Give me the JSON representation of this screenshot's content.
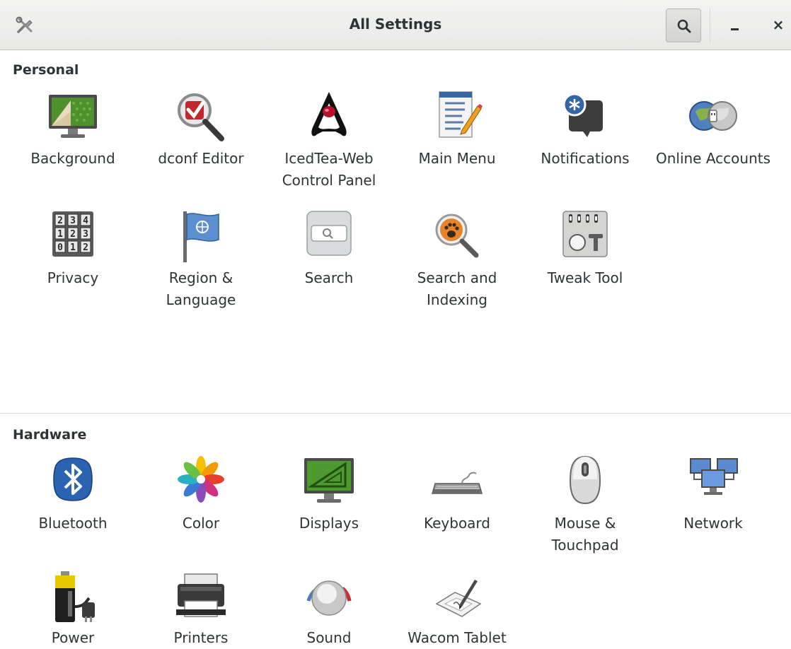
{
  "window": {
    "title": "All Settings",
    "tools_icon": "tools-icon",
    "search_icon": "search-icon",
    "minimize_label": "",
    "close_label": "×"
  },
  "sections": {
    "personal": {
      "title": "Personal",
      "items": [
        {
          "label": "Background",
          "icon": "background-icon"
        },
        {
          "label": "dconf Editor",
          "icon": "dconf-editor-icon"
        },
        {
          "label": "IcedTea-Web Control Panel",
          "icon": "icedtea-web-icon"
        },
        {
          "label": "Main Menu",
          "icon": "main-menu-icon"
        },
        {
          "label": "Notifications",
          "icon": "notifications-icon"
        },
        {
          "label": "Online Accounts",
          "icon": "online-accounts-icon"
        },
        {
          "label": "Privacy",
          "icon": "privacy-icon"
        },
        {
          "label": "Region & Language",
          "icon": "region-language-icon"
        },
        {
          "label": "Search",
          "icon": "search-settings-icon"
        },
        {
          "label": "Search and Indexing",
          "icon": "search-indexing-icon"
        },
        {
          "label": "Tweak Tool",
          "icon": "tweak-tool-icon"
        }
      ]
    },
    "hardware": {
      "title": "Hardware",
      "items": [
        {
          "label": "Bluetooth",
          "icon": "bluetooth-icon"
        },
        {
          "label": "Color",
          "icon": "color-icon"
        },
        {
          "label": "Displays",
          "icon": "displays-icon"
        },
        {
          "label": "Keyboard",
          "icon": "keyboard-icon"
        },
        {
          "label": "Mouse & Touchpad",
          "icon": "mouse-touchpad-icon"
        },
        {
          "label": "Network",
          "icon": "network-icon"
        },
        {
          "label": "Power",
          "icon": "power-icon"
        },
        {
          "label": "Printers",
          "icon": "printers-icon"
        },
        {
          "label": "Sound",
          "icon": "sound-icon"
        },
        {
          "label": "Wacom Tablet",
          "icon": "wacom-tablet-icon"
        }
      ]
    }
  },
  "colors": {
    "headerbar": "#e8e8e7",
    "text": "#2e3436",
    "divider": "#dcdcda"
  }
}
